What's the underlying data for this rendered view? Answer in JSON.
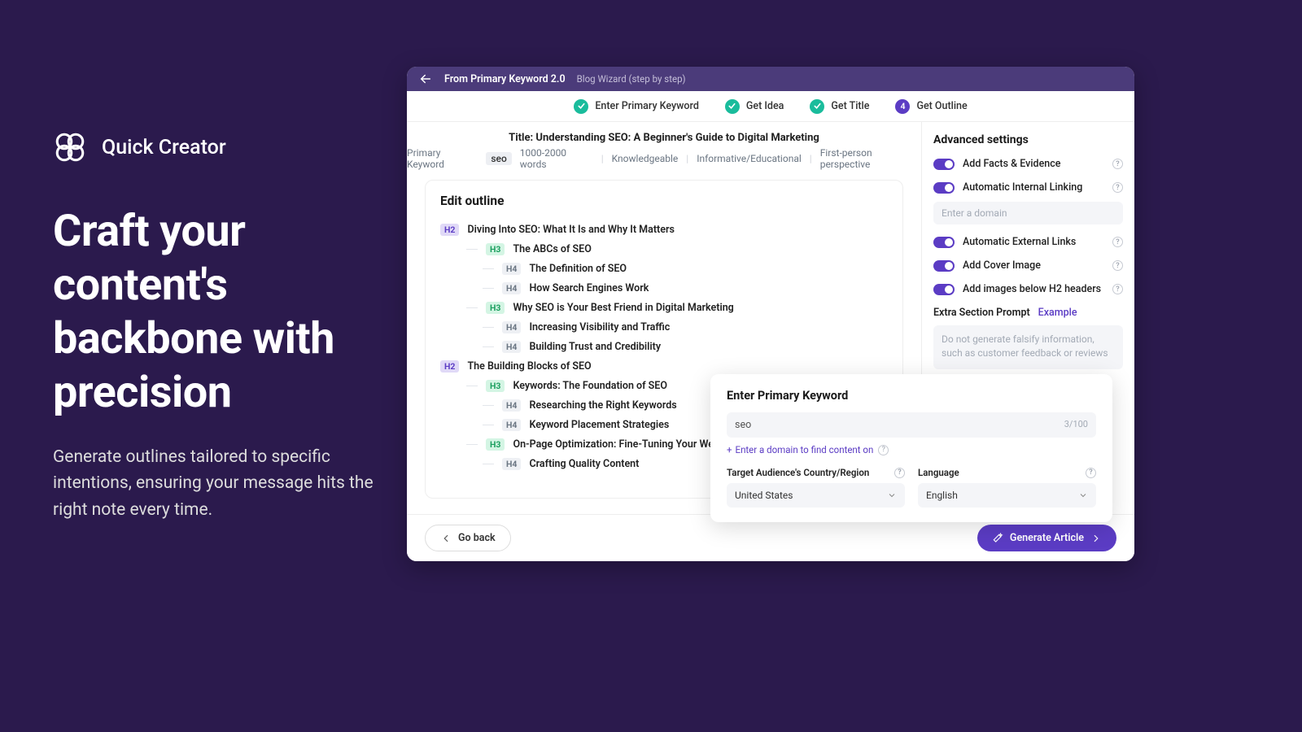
{
  "hero": {
    "brand": "Quick Creator",
    "title": "Craft your content's backbone with precision",
    "subtitle": "Generate outlines tailored to specific intentions, ensuring your message hits the right note every time."
  },
  "header": {
    "title": "From Primary Keyword 2.0",
    "subtitle": "Blog Wizard (step by step)"
  },
  "steps": {
    "s1": "Enter Primary Keyword",
    "s2": "Get Idea",
    "s3": "Get Title",
    "s4_num": "4",
    "s4": "Get Outline"
  },
  "article": {
    "title_label": "Title: Understanding SEO: A Beginner's Guide to Digital Marketing",
    "pk_label": "Primary Keyword",
    "pk_value": "seo",
    "words": "1000-2000 words",
    "tone": "Knowledgeable",
    "style": "Informative/Educational",
    "perspective": "First-person perspective"
  },
  "outline": {
    "heading": "Edit outline",
    "items": [
      {
        "level": 2,
        "text": "Diving Into SEO: What It Is and Why It Matters"
      },
      {
        "level": 3,
        "text": "The ABCs of SEO"
      },
      {
        "level": 4,
        "text": "The Definition of SEO"
      },
      {
        "level": 4,
        "text": "How Search Engines Work"
      },
      {
        "level": 3,
        "text": "Why SEO is Your Best Friend in Digital Marketing"
      },
      {
        "level": 4,
        "text": "Increasing Visibility and Traffic"
      },
      {
        "level": 4,
        "text": "Building Trust and Credibility"
      },
      {
        "level": 2,
        "text": "The Building Blocks of SEO"
      },
      {
        "level": 3,
        "text": "Keywords: The Foundation of SEO"
      },
      {
        "level": 4,
        "text": "Researching the Right Keywords"
      },
      {
        "level": 4,
        "text": "Keyword Placement Strategies"
      },
      {
        "level": 3,
        "text": "On-Page Optimization: Fine-Tuning Your Website"
      },
      {
        "level": 4,
        "text": "Crafting Quality Content"
      }
    ]
  },
  "advanced": {
    "heading": "Advanced settings",
    "facts": "Add Facts & Evidence",
    "internal": "Automatic Internal Linking",
    "domain_ph": "Enter a domain",
    "external": "Automatic External Links",
    "cover": "Add Cover Image",
    "images": "Add images below H2 headers",
    "extra_label": "Extra Section Prompt",
    "example": "Example",
    "extra_ph": "Do not generate falsify information, such as customer feedback or reviews"
  },
  "footer": {
    "back": "Go back",
    "generate": "Generate Article"
  },
  "popup": {
    "title": "Enter Primary Keyword",
    "value": "seo",
    "counter": "3/100",
    "domain_link": "Enter a domain to find content on",
    "region_label": "Target Audience's Country/Region",
    "region_value": "United States",
    "lang_label": "Language",
    "lang_value": "English"
  }
}
